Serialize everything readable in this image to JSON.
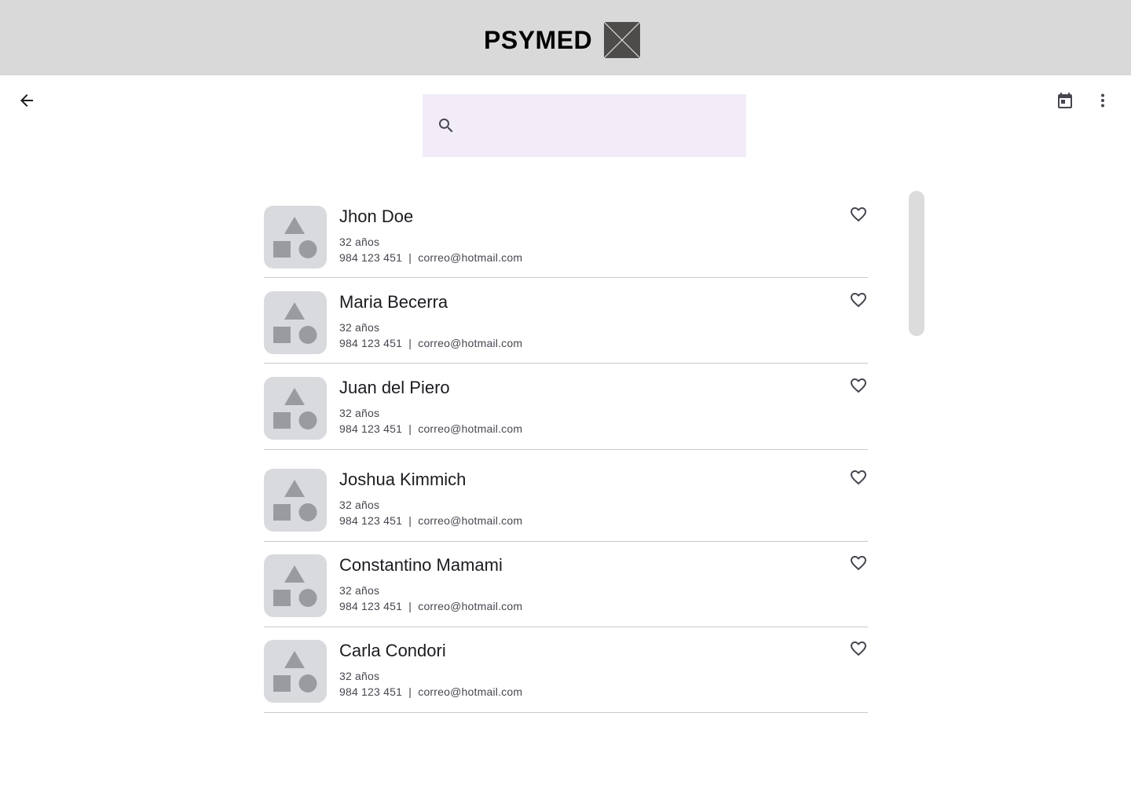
{
  "header": {
    "brand": "PSYMED",
    "logo_icon": "image-placeholder-icon"
  },
  "toolbar": {
    "back_icon": "arrow-back-icon",
    "calendar_icon": "calendar-icon",
    "more_icon": "more-vert-icon"
  },
  "search": {
    "icon": "search-icon",
    "value": "",
    "placeholder": ""
  },
  "patients": [
    {
      "name": "Jhon Doe",
      "age": "32 años",
      "contact": "984 123 451  |  correo@hotmail.com"
    },
    {
      "name": "Maria Becerra",
      "age": "32 años",
      "contact": "984 123 451  |  correo@hotmail.com"
    },
    {
      "name": "Juan del Piero",
      "age": "32 años",
      "contact": "984 123 451  |  correo@hotmail.com"
    },
    {
      "name": "Joshua Kimmich",
      "age": "32 años",
      "contact": "984 123 451  |  correo@hotmail.com"
    },
    {
      "name": "Constantino Mamami",
      "age": "32 años",
      "contact": "984 123 451  |  correo@hotmail.com"
    },
    {
      "name": "Carla Condori",
      "age": "32 años",
      "contact": "984 123 451  |  correo@hotmail.com"
    }
  ],
  "colors": {
    "header_bg": "#d9d9d9",
    "search_bg": "#f1ecf8",
    "thumb_bg": "#d9dade",
    "thumb_shapes": "#9a9ba0"
  }
}
